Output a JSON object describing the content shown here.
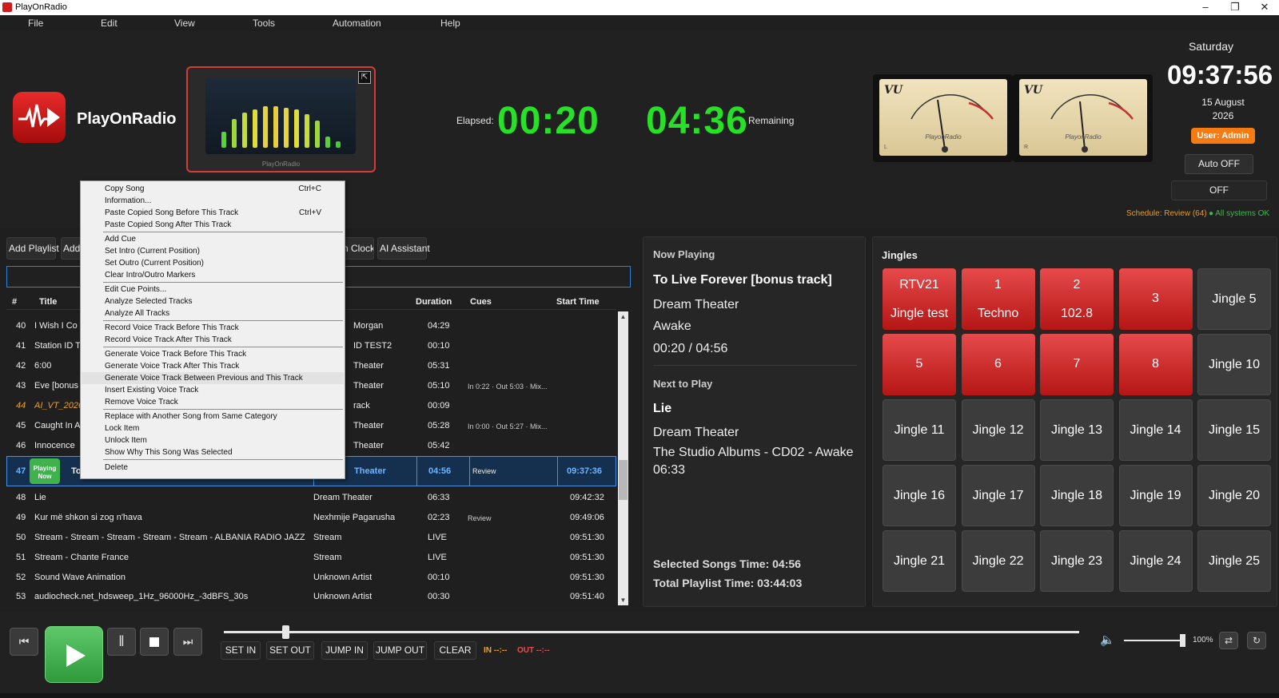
{
  "window": {
    "title": "PlayOnRadio"
  },
  "menu": [
    "File",
    "Edit",
    "View",
    "Tools",
    "Automation",
    "Help"
  ],
  "brand": {
    "name": "PlayOnRadio",
    "viz_caption": "PlayOnRadio"
  },
  "timers": {
    "elapsed_label": "Elapsed:",
    "elapsed": "00:20",
    "remaining": "04:36",
    "remaining_label": "Remaining"
  },
  "vu": {
    "label": "VU",
    "brand": "PlayonRadio",
    "left_ch": "L",
    "right_ch": "R"
  },
  "clock": {
    "day": "Saturday",
    "time": "09:37:56",
    "date_line1": "15 August",
    "date_line2": "2026"
  },
  "user": {
    "badge": "User: Admin"
  },
  "controls": {
    "auto": "Auto OFF",
    "off": "OFF"
  },
  "status": {
    "schedule": "Schedule: Review (64)",
    "systems": "● All systems OK"
  },
  "toolbar": {
    "add_playlist": "Add Playlist",
    "add": "Add",
    "clock": "n Clock",
    "ai": "AI Assistant"
  },
  "playlist": {
    "columns": {
      "num": "#",
      "title": "Title",
      "duration": "Duration",
      "cues": "Cues",
      "start": "Start Time"
    },
    "rows": [
      {
        "num": "40",
        "title": "I Wish I Co",
        "artist": "Morgan",
        "duration": "04:29",
        "cues": "",
        "start": ""
      },
      {
        "num": "41",
        "title": "Station ID T",
        "artist": "ID TEST2",
        "duration": "00:10",
        "cues": "",
        "start": ""
      },
      {
        "num": "42",
        "title": "6:00",
        "artist": "Theater",
        "duration": "05:31",
        "cues": "",
        "start": ""
      },
      {
        "num": "43",
        "title": "Eve [bonus",
        "artist": "Theater",
        "duration": "05:10",
        "cues": "In 0:22 · Out 5:03 · Mix...",
        "start": ""
      },
      {
        "num": "44",
        "title": "AI_VT_2026",
        "artist": "rack",
        "duration": "00:09",
        "cues": "",
        "start": "",
        "vt": true
      },
      {
        "num": "45",
        "title": "Caught In A",
        "artist": "Theater",
        "duration": "05:28",
        "cues": "In 0:00 · Out 5:27 · Mix...",
        "start": ""
      },
      {
        "num": "46",
        "title": "Innocence",
        "artist": "Theater",
        "duration": "05:42",
        "cues": "",
        "start": ""
      }
    ],
    "current": {
      "num": "47",
      "badge_line1": "Playing",
      "badge_line2": "Now",
      "title": "To",
      "artist": "Theater",
      "duration": "04:56",
      "cues": "Review",
      "start": "09:37:36"
    },
    "rows_after": [
      {
        "num": "48",
        "title": "Lie",
        "artist": "Dream Theater",
        "duration": "06:33",
        "cues": "",
        "start": "09:42:32"
      },
      {
        "num": "49",
        "title": "Kur më shkon si zog n'hava",
        "artist": "Nexhmije Pagarusha",
        "duration": "02:23",
        "cues": "Review",
        "start": "09:49:06"
      },
      {
        "num": "50",
        "title": "Stream - Stream - Stream - Stream - Stream - ALBANIA  RADIO JAZZ",
        "artist": "Stream",
        "duration": "LIVE",
        "cues": "",
        "start": "09:51:30"
      },
      {
        "num": "51",
        "title": "Stream - Chante France",
        "artist": "Stream",
        "duration": "LIVE",
        "cues": "",
        "start": "09:51:30"
      },
      {
        "num": "52",
        "title": "Sound Wave Animation",
        "artist": "Unknown Artist",
        "duration": "00:10",
        "cues": "",
        "start": "09:51:30"
      },
      {
        "num": "53",
        "title": "audiocheck.net_hdsweep_1Hz_96000Hz_-3dBFS_30s",
        "artist": "Unknown Artist",
        "duration": "00:30",
        "cues": "",
        "start": "09:51:40"
      }
    ]
  },
  "context_menu": {
    "items": [
      {
        "label": "Copy Song",
        "shortcut": "Ctrl+C"
      },
      {
        "label": "Information...",
        "shortcut": ""
      },
      {
        "label": "Paste Copied Song Before This Track",
        "shortcut": "Ctrl+V"
      },
      {
        "label": "Paste Copied Song After This Track",
        "shortcut": ""
      },
      {
        "label": "Add Cue",
        "shortcut": ""
      },
      {
        "label": "Set Intro (Current Position)",
        "shortcut": ""
      },
      {
        "label": "Set Outro (Current Position)",
        "shortcut": ""
      },
      {
        "label": "Clear Intro/Outro Markers",
        "shortcut": ""
      },
      {
        "label": "Edit Cue Points...",
        "shortcut": ""
      },
      {
        "label": "Analyze Selected Tracks",
        "shortcut": ""
      },
      {
        "label": "Analyze All Tracks",
        "shortcut": ""
      },
      {
        "label": "Record Voice Track Before This Track",
        "shortcut": ""
      },
      {
        "label": "Record Voice Track After This Track",
        "shortcut": ""
      },
      {
        "label": "Generate Voice Track Before This Track",
        "shortcut": ""
      },
      {
        "label": "Generate Voice Track After This Track",
        "shortcut": ""
      },
      {
        "label": "Generate Voice Track Between Previous and This Track",
        "shortcut": ""
      },
      {
        "label": "Insert Existing Voice Track",
        "shortcut": ""
      },
      {
        "label": "Remove Voice Track",
        "shortcut": ""
      },
      {
        "label": "Replace with Another Song from Same Category",
        "shortcut": ""
      },
      {
        "label": "Lock Item",
        "shortcut": ""
      },
      {
        "label": "Unlock Item",
        "shortcut": ""
      },
      {
        "label": "Show Why This Song Was Selected",
        "shortcut": ""
      },
      {
        "label": "Delete",
        "shortcut": ""
      }
    ]
  },
  "now_playing": {
    "header": "Now Playing",
    "title": "To Live Forever [bonus track]",
    "artist": "Dream Theater",
    "album": "Awake",
    "progress": "00:20 / 04:56",
    "next_header": "Next to Play",
    "next_title": "Lie",
    "next_artist": "Dream Theater",
    "next_album": "The Studio Albums - CD02 - Awake",
    "next_duration": "06:33",
    "selected_time": "Selected Songs Time: 04:56",
    "total_time": "Total Playlist Time: 03:44:03"
  },
  "jingles": {
    "header": "Jingles",
    "buttons": [
      {
        "l1": "RTV21",
        "l2": "Jingle test",
        "color": "red"
      },
      {
        "l1": "1",
        "l2": "Techno",
        "color": "red"
      },
      {
        "l1": "2",
        "l2": "102.8",
        "color": "red"
      },
      {
        "l1": "3",
        "l2": "",
        "color": "red"
      },
      {
        "l1": "Jingle 5",
        "l2": "",
        "color": "gray"
      },
      {
        "l1": "5",
        "l2": "",
        "color": "red"
      },
      {
        "l1": "6",
        "l2": "",
        "color": "red"
      },
      {
        "l1": "7",
        "l2": "",
        "color": "red"
      },
      {
        "l1": "8",
        "l2": "",
        "color": "red"
      },
      {
        "l1": "Jingle 10",
        "l2": "",
        "color": "gray"
      },
      {
        "l1": "Jingle 11",
        "l2": "",
        "color": "gray"
      },
      {
        "l1": "Jingle 12",
        "l2": "",
        "color": "gray"
      },
      {
        "l1": "Jingle 13",
        "l2": "",
        "color": "gray"
      },
      {
        "l1": "Jingle 14",
        "l2": "",
        "color": "gray"
      },
      {
        "l1": "Jingle 15",
        "l2": "",
        "color": "gray"
      },
      {
        "l1": "Jingle 16",
        "l2": "",
        "color": "gray"
      },
      {
        "l1": "Jingle 17",
        "l2": "",
        "color": "gray"
      },
      {
        "l1": "Jingle 18",
        "l2": "",
        "color": "gray"
      },
      {
        "l1": "Jingle 19",
        "l2": "",
        "color": "gray"
      },
      {
        "l1": "Jingle 20",
        "l2": "",
        "color": "gray"
      },
      {
        "l1": "Jingle 21",
        "l2": "",
        "color": "gray"
      },
      {
        "l1": "Jingle 22",
        "l2": "",
        "color": "gray"
      },
      {
        "l1": "Jingle 23",
        "l2": "",
        "color": "gray"
      },
      {
        "l1": "Jingle 24",
        "l2": "",
        "color": "gray"
      },
      {
        "l1": "Jingle 25",
        "l2": "",
        "color": "gray"
      }
    ]
  },
  "transport": {
    "set_in": "SET IN",
    "set_out": "SET OUT",
    "jump_in": "JUMP IN",
    "jump_out": "JUMP OUT",
    "clear": "CLEAR",
    "in_marker": "IN --:--",
    "out_marker": "OUT --:--",
    "volume": "100%",
    "seek_fraction": 0.068,
    "volume_fraction": 1.0
  },
  "colors": {
    "accent_green": "#28e028",
    "accent_red": "#d11a1a",
    "accent_orange": "#f57b12",
    "selection_blue": "#4a90e2"
  }
}
